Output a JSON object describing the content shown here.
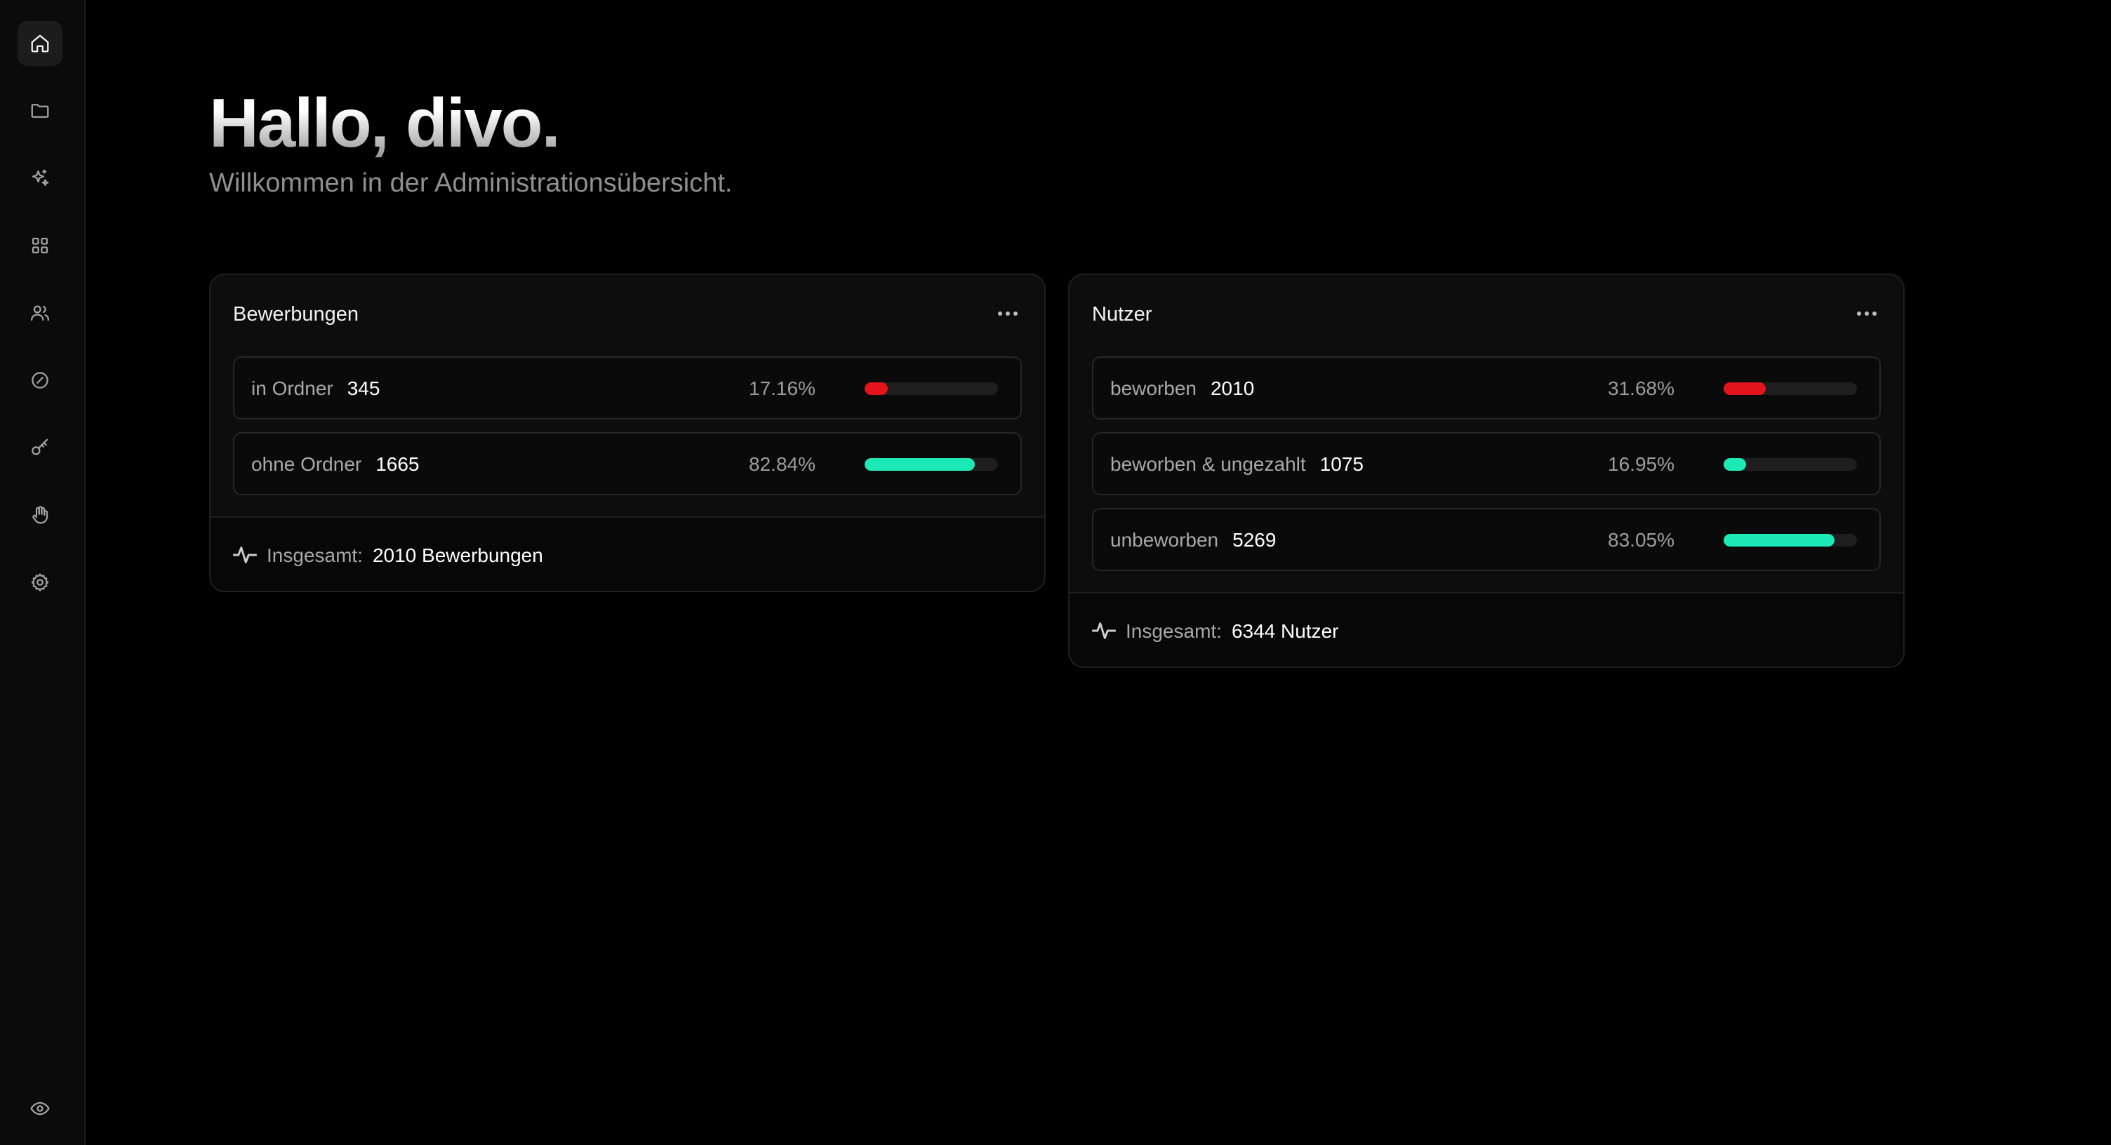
{
  "sidebar": {
    "items": [
      {
        "icon": "home-icon",
        "active": true
      },
      {
        "icon": "folder-icon"
      },
      {
        "icon": "sparkles-icon"
      },
      {
        "icon": "grid-icon"
      },
      {
        "icon": "users-icon"
      },
      {
        "icon": "gauge-icon"
      },
      {
        "icon": "key-icon"
      },
      {
        "icon": "hand-icon"
      },
      {
        "icon": "settings-icon"
      }
    ],
    "bottom": {
      "icon": "eye-icon"
    }
  },
  "header": {
    "greeting": "Hallo, divo.",
    "subtitle": "Willkommen in der Administrationsübersicht."
  },
  "colors": {
    "accent_positive": "#1de9b6",
    "accent_negative": "#e3141c"
  },
  "cards": [
    {
      "title": "Bewerbungen",
      "rows": [
        {
          "label": "in Ordner",
          "value": "345",
          "percent": "17.16%",
          "fill": 0.1716,
          "color": "#e3141c"
        },
        {
          "label": "ohne Ordner",
          "value": "1665",
          "percent": "82.84%",
          "fill": 0.8284,
          "color": "#1de9b6"
        }
      ],
      "footer": {
        "label": "Insgesamt:",
        "value": "2010 Bewerbungen",
        "icon": "activity-icon"
      }
    },
    {
      "title": "Nutzer",
      "rows": [
        {
          "label": "beworben",
          "value": "2010",
          "percent": "31.68%",
          "fill": 0.3168,
          "color": "#e3141c"
        },
        {
          "label": "beworben & ungezahlt",
          "value": "1075",
          "percent": "16.95%",
          "fill": 0.1695,
          "color": "#1de9b6"
        },
        {
          "label": "unbeworben",
          "value": "5269",
          "percent": "83.05%",
          "fill": 0.8305,
          "color": "#1de9b6"
        }
      ],
      "footer": {
        "label": "Insgesamt:",
        "value": "6344 Nutzer",
        "icon": "activity-icon"
      }
    }
  ]
}
